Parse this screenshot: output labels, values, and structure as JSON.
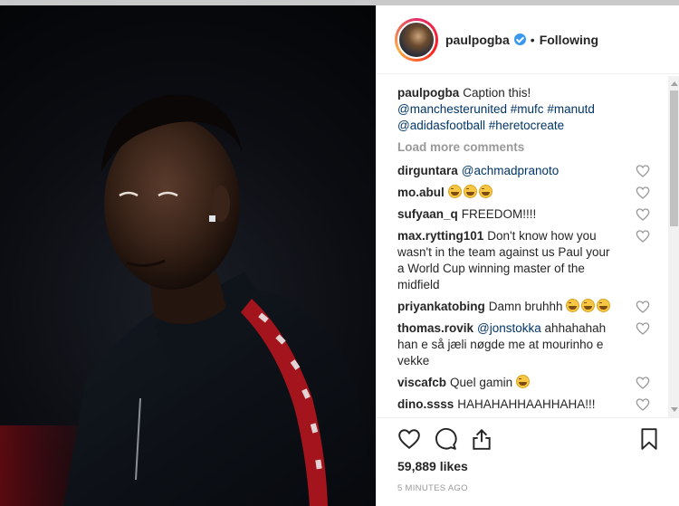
{
  "post": {
    "username": "paulpogba",
    "follow_status": "Following",
    "caption": {
      "text": "Caption this!",
      "tags": [
        "@manchesterunited",
        "#mufc",
        "#manutd",
        "@adidasfootball",
        "#heretocreate"
      ]
    },
    "load_more": "Load more comments",
    "comments": [
      {
        "user": "dirguntara",
        "text": "@achmadpranoto",
        "is_link": true,
        "emoji": 0
      },
      {
        "user": "mo.abul",
        "text": "",
        "emoji": 3
      },
      {
        "user": "sufyaan_q",
        "text": "FREEDOM!!!!",
        "emoji": 0
      },
      {
        "user": "max.rytting101",
        "text": "Don't know how you wasn't in the team against us Paul your a World Cup winning master of the midfield",
        "emoji": 0
      },
      {
        "user": "priyankatobing",
        "text": "Damn bruhhh",
        "emoji": 3
      },
      {
        "user": "thomas.rovik",
        "mention": "@jonstokka",
        "text": "ahhahahah han e så jæli nøgde me at mourinho e vekke",
        "emoji": 0
      },
      {
        "user": "viscafcb",
        "text": "Quel gamin",
        "emoji": 1
      },
      {
        "user": "dino.ssss",
        "text": "HAHAHAHHAAHHAHA!!!",
        "emoji": 0
      }
    ],
    "likes": "59,889 likes",
    "timestamp": "5 MINUTES AGO"
  },
  "colors": {
    "link": "#003569",
    "verified": "#3897f0",
    "muted": "#999999"
  },
  "icons": [
    "heart-icon",
    "comment-icon",
    "share-icon",
    "bookmark-icon",
    "verified-badge-icon"
  ]
}
